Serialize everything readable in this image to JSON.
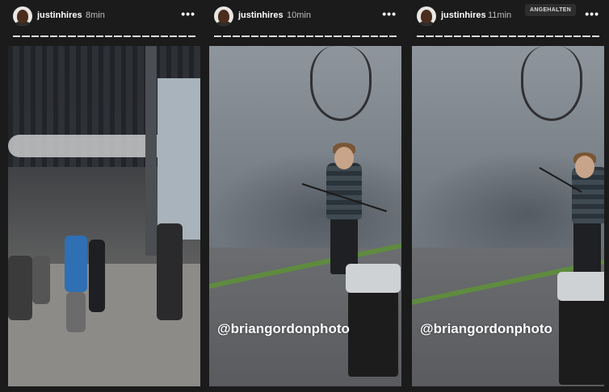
{
  "stories": [
    {
      "username": "justinhires",
      "time": "8min",
      "more": "•••",
      "mention": ""
    },
    {
      "username": "justinhires",
      "time": "10min",
      "more": "•••",
      "mention": "@briangordonphoto"
    },
    {
      "username": "justinhires",
      "time": "11min",
      "more": "•••",
      "mention": "@briangordonphoto"
    }
  ],
  "paused_badge": "ANGEHALTEN",
  "icons": {
    "more": "more-options-icon",
    "avatar": "profile-avatar"
  },
  "colors": {
    "background": "#1b1b1b",
    "text": "#ffffff",
    "time": "#bdbdbd"
  }
}
